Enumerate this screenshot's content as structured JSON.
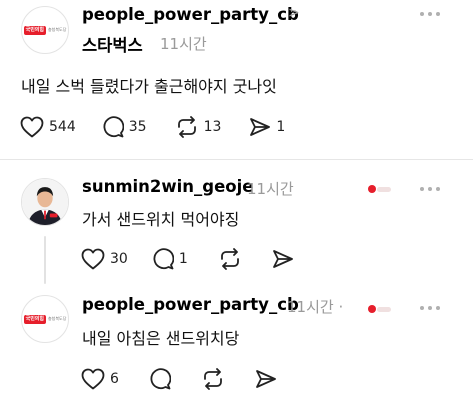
{
  "post1": {
    "username": "people_power_party_cb",
    "chevron": ">",
    "subtitle": "스타벅스",
    "time": "11시간",
    "text": "내일 스벅 들렸다가 출근해야지 굿나잇",
    "likes": "544",
    "comments": "35",
    "reposts": "13",
    "shares": "1"
  },
  "reply1": {
    "username": "sunmin2win_geoje",
    "time": "11시간",
    "text": "가서 샌드위치 먹어야징",
    "likes": "30",
    "comments": "1"
  },
  "reply2": {
    "username": "people_power_party_cb",
    "time": "11시간 · ",
    "text": "내일 아침은 샌드위치당",
    "likes": "6"
  },
  "logo": {
    "red": "국민의힘",
    "grey": "충청북도당"
  },
  "colors": {
    "accent": "#e61e2b",
    "muted": "#9a9a9a",
    "divider": "#e6e6e6"
  },
  "icons": [
    "heart-icon",
    "comment-icon",
    "repost-icon",
    "share-icon",
    "more-icon"
  ]
}
